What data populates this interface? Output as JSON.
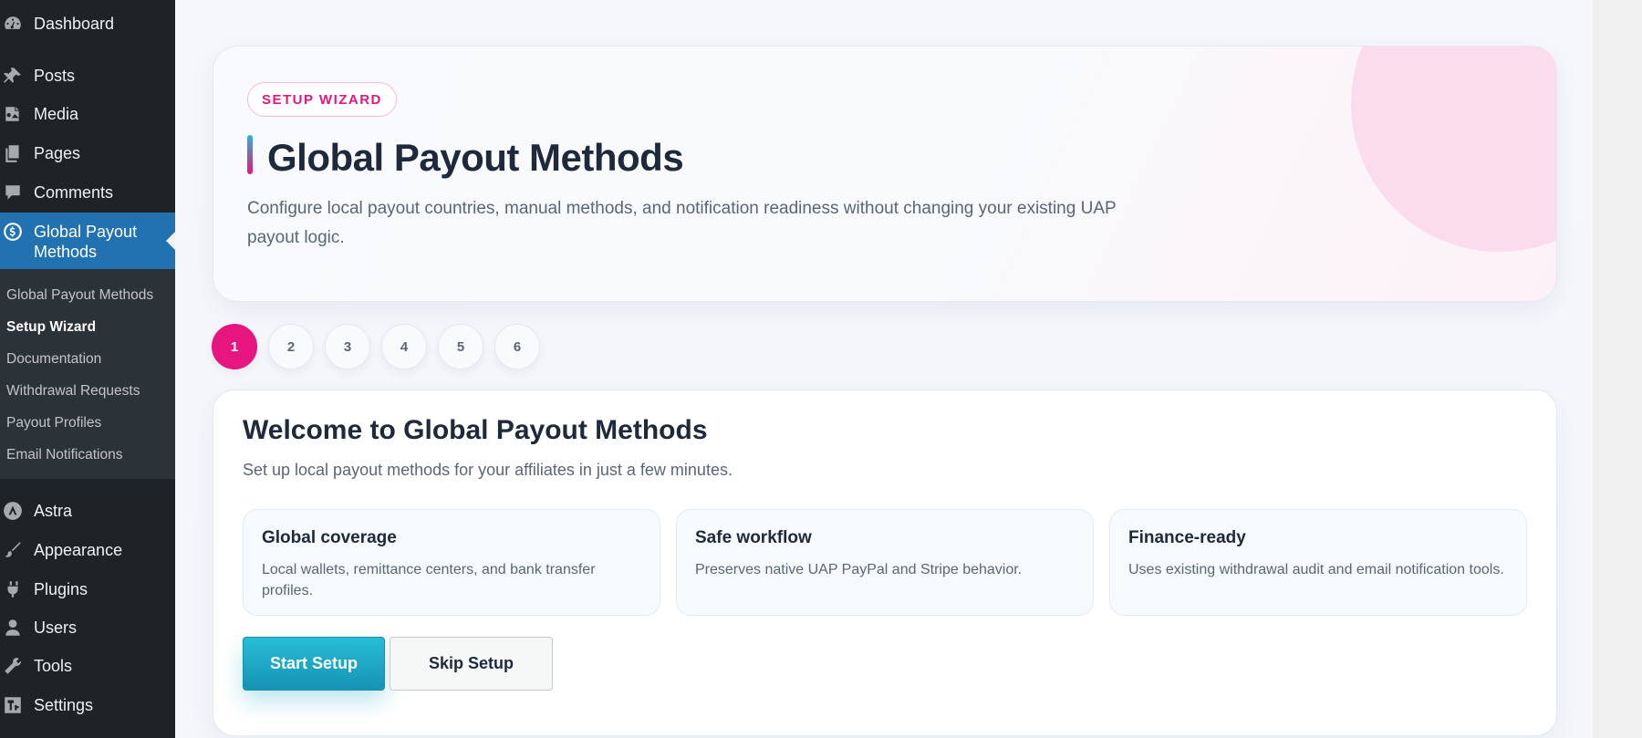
{
  "sidebar": {
    "items": [
      {
        "label": "Dashboard",
        "icon": "dashboard-icon"
      },
      {
        "label": "Posts",
        "icon": "pushpin-icon"
      },
      {
        "label": "Media",
        "icon": "media-icon"
      },
      {
        "label": "Pages",
        "icon": "pages-icon"
      },
      {
        "label": "Comments",
        "icon": "comment-icon"
      },
      {
        "label": "Global Payout Methods",
        "icon": "dollar-icon"
      },
      {
        "label": "Astra",
        "icon": "astra-icon"
      },
      {
        "label": "Appearance",
        "icon": "paintbrush-icon"
      },
      {
        "label": "Plugins",
        "icon": "plugin-icon"
      },
      {
        "label": "Users",
        "icon": "users-icon"
      },
      {
        "label": "Tools",
        "icon": "wrench-icon"
      },
      {
        "label": "Settings",
        "icon": "settings-icon"
      }
    ],
    "submenu": [
      "Global Payout Methods",
      "Setup Wizard",
      "Documentation",
      "Withdrawal Requests",
      "Payout Profiles",
      "Email Notifications"
    ],
    "active_item": "Global Payout Methods",
    "current_submenu": "Setup Wizard"
  },
  "hero": {
    "badge": "SETUP WIZARD",
    "title": "Global Payout Methods",
    "description": "Configure local payout countries, manual methods, and notification readiness without changing your existing UAP payout logic."
  },
  "steps": [
    "1",
    "2",
    "3",
    "4",
    "5",
    "6"
  ],
  "active_step": "1",
  "card": {
    "title": "Welcome to Global Payout Methods",
    "subtitle": "Set up local payout methods for your affiliates in just a few minutes.",
    "features": [
      {
        "title": "Global coverage",
        "text": "Local wallets, remittance centers, and bank transfer profiles."
      },
      {
        "title": "Safe workflow",
        "text": "Preserves native UAP PayPal and Stripe behavior."
      },
      {
        "title": "Finance-ready",
        "text": "Uses existing withdrawal audit and email notification tools."
      }
    ],
    "start_label": "Start Setup",
    "skip_label": "Skip Setup"
  },
  "colors": {
    "accent_pink": "#e6157f",
    "accent_cyan": "#1aa7c6",
    "sidebar_bg": "#1d2327",
    "sidebar_active": "#2271b1"
  }
}
